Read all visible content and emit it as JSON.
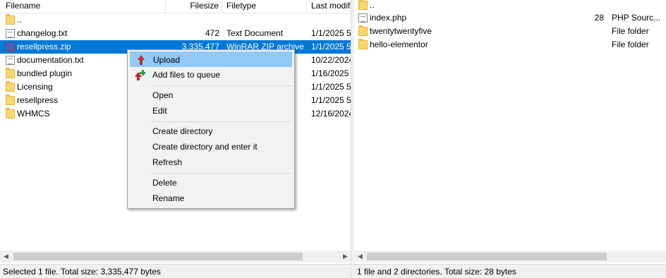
{
  "left_pane": {
    "columns": {
      "filename": "Filename",
      "filesize": "Filesize",
      "filetype": "Filetype",
      "last_modified": "Last modifi"
    },
    "rows": [
      {
        "name": "..",
        "size": "",
        "type": "",
        "modified": "",
        "icon": "folder-icon"
      },
      {
        "name": "changelog.txt",
        "size": "472",
        "type": "Text Document",
        "modified": "1/1/2025 5",
        "icon": "text-file-icon"
      },
      {
        "name": "resellpress.zip",
        "size": "3,335,477",
        "type": "WinRAR ZIP archive",
        "modified": "1/1/2025 5",
        "icon": "zip-archive-icon",
        "selected": true
      },
      {
        "name": "documentation.txt",
        "size": "",
        "type": "",
        "modified": "10/22/2024",
        "icon": "text-file-icon"
      },
      {
        "name": "bundled plugin",
        "size": "",
        "type": "",
        "modified": "1/16/2025",
        "icon": "folder-icon"
      },
      {
        "name": "Licensing",
        "size": "",
        "type": "",
        "modified": "1/1/2025 5",
        "icon": "folder-icon"
      },
      {
        "name": "resellpress",
        "size": "",
        "type": "",
        "modified": "1/1/2025 5",
        "icon": "folder-icon"
      },
      {
        "name": "WHMCS",
        "size": "",
        "type": "",
        "modified": "12/16/2024",
        "icon": "folder-icon"
      }
    ],
    "status": "Selected 1 file. Total size: 3,335,477 bytes"
  },
  "right_pane": {
    "rows": [
      {
        "name": "..",
        "size": "",
        "type": "",
        "icon": "folder-icon"
      },
      {
        "name": "index.php",
        "size": "28",
        "type": "PHP Sourc...",
        "icon": "text-file-icon"
      },
      {
        "name": "twentytwentyfive",
        "size": "",
        "type": "File folder",
        "icon": "folder-icon"
      },
      {
        "name": "hello-elementor",
        "size": "",
        "type": "File folder",
        "icon": "folder-icon"
      }
    ],
    "status": "1 file and 2 directories. Total size: 28 bytes"
  },
  "context_menu": {
    "items": {
      "upload": "Upload",
      "add_to_queue": "Add files to queue",
      "open": "Open",
      "edit": "Edit",
      "create_directory": "Create directory",
      "create_directory_enter": "Create directory and enter it",
      "refresh": "Refresh",
      "delete": "Delete",
      "rename": "Rename"
    }
  },
  "colors": {
    "selection": "#0078d7",
    "menu_hover": "#91c9f7",
    "folder": "#ffd66b",
    "upload_arrow": "#c0272d",
    "queue_plus": "#22a33a"
  }
}
